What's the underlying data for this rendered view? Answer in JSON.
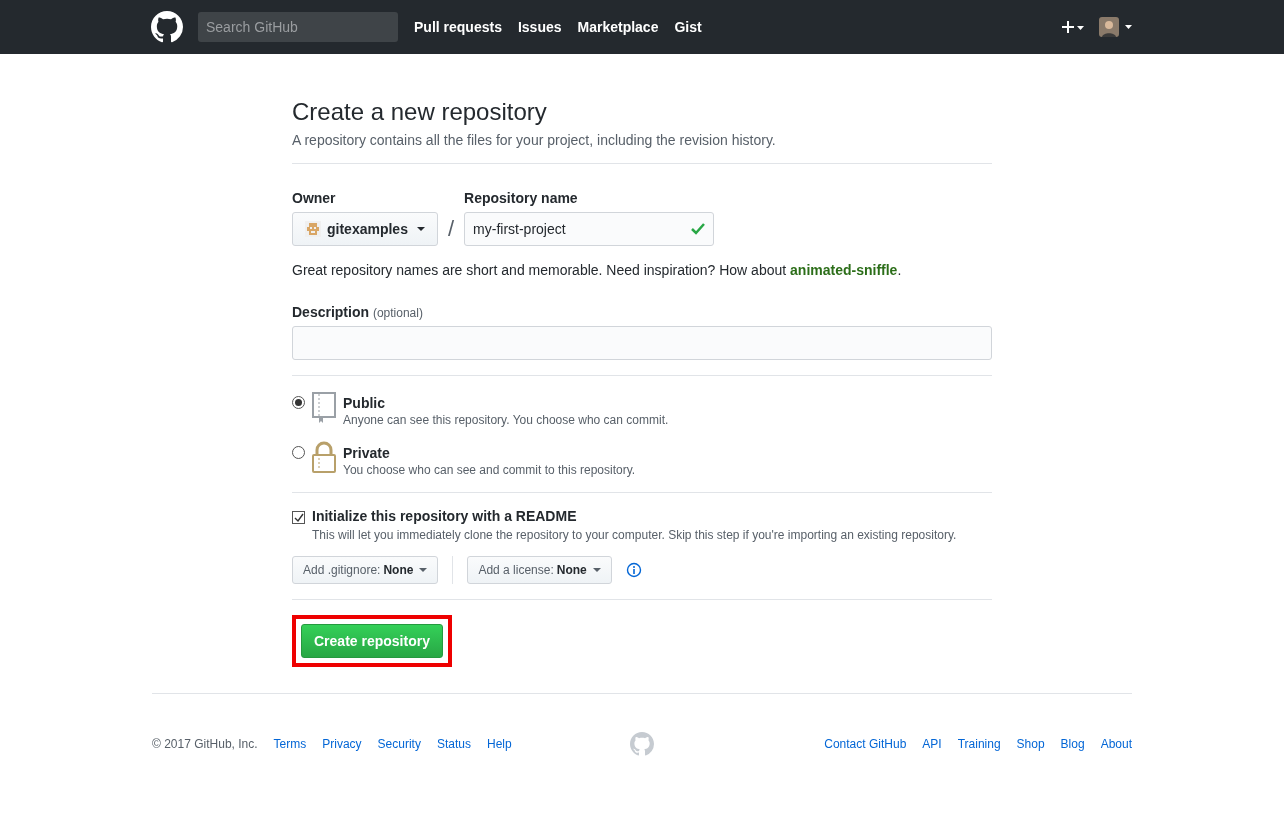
{
  "header": {
    "search": {
      "placeholder": "Search GitHub"
    },
    "nav": [
      "Pull requests",
      "Issues",
      "Marketplace",
      "Gist"
    ]
  },
  "page": {
    "title": "Create a new repository",
    "subtitle": "A repository contains all the files for your project, including the revision history."
  },
  "owner": {
    "label": "Owner",
    "value": "gitexamples"
  },
  "separator": "/",
  "repo_name": {
    "label": "Repository name",
    "value": "my-first-project",
    "valid": true
  },
  "suggestion": {
    "text": "Great repository names are short and memorable. Need inspiration? How about ",
    "link": "animated-sniffle",
    "suffix": "."
  },
  "description": {
    "label": "Description",
    "hint": "(optional)"
  },
  "visibility": [
    {
      "kind": "public",
      "label": "Public",
      "note": "Anyone can see this repository. You choose who can commit.",
      "selected": true
    },
    {
      "kind": "private",
      "label": "Private",
      "note": "You choose who can see and commit to this repository.",
      "selected": false
    }
  ],
  "readme": {
    "label": "Initialize this repository with a README",
    "note": "This will let you immediately clone the repository to your computer. Skip this step if you're importing an existing repository.",
    "checked": true
  },
  "dropdowns": [
    {
      "label": "Add .gitignore:",
      "value": "None"
    },
    {
      "label": "Add a license:",
      "value": "None"
    }
  ],
  "submit": {
    "label": "Create repository",
    "highlighted": true
  },
  "footer": {
    "copyright": "© 2017 GitHub, Inc.",
    "left_links": [
      "Terms",
      "Privacy",
      "Security",
      "Status",
      "Help"
    ],
    "right_links": [
      "Contact GitHub",
      "API",
      "Training",
      "Shop",
      "Blog",
      "About"
    ]
  }
}
